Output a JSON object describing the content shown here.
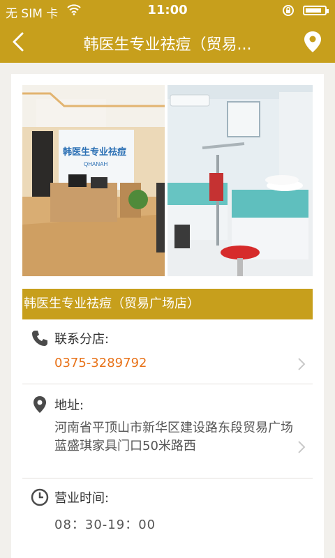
{
  "status_bar": {
    "carrier": "无 SIM 卡",
    "time": "11:00",
    "battery_level": 0.85
  },
  "nav": {
    "title": "韩医生专业祛痘（贸易..."
  },
  "shop": {
    "name": "韩医生专业祛痘（贸易广场店）"
  },
  "photos": {
    "sign_text": "韩医生专业祛痘",
    "sign_sub": "QHANAH"
  },
  "contact": {
    "label": "联系分店:",
    "phone": "0375-3289792"
  },
  "address": {
    "label": "地址:",
    "text": "河南省平顶山市新华区建设路东段贸易广场蓝盛琪家具门口50米路西"
  },
  "hours": {
    "label": "营业时间:",
    "text": "08：30-19：00"
  },
  "colors": {
    "accent": "#c79f1c",
    "phone": "#e8731a"
  },
  "icons": [
    "back-arrow-icon",
    "location-pin-icon",
    "phone-icon",
    "map-pin-icon",
    "clock-icon",
    "chevron-right-icon"
  ]
}
